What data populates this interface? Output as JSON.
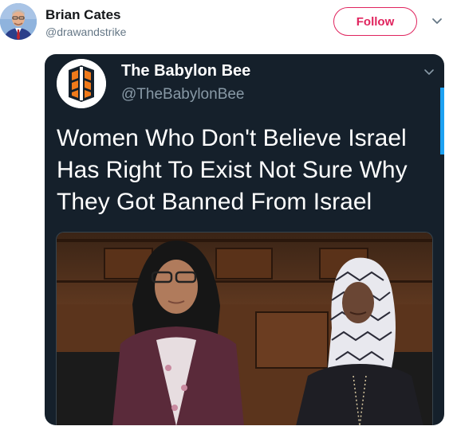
{
  "tweet": {
    "author_name": "Brian Cates",
    "author_handle": "@drawandstrike",
    "follow_label": "Follow"
  },
  "quoted": {
    "name": "The Babylon Bee",
    "handle": "@TheBabylonBee",
    "headline": "Women Who Don't Believe Israel Has Right To Exist Not Sure Why They Got Banned From Israel"
  },
  "colors": {
    "follow_accent": "#e0245e",
    "card_bg": "#15202b",
    "bee_orange": "#f07a1a"
  },
  "icons": {
    "menu": "chevron-down-icon",
    "card_menu": "chevron-down-icon",
    "logo": "babylon-bee-logo"
  }
}
